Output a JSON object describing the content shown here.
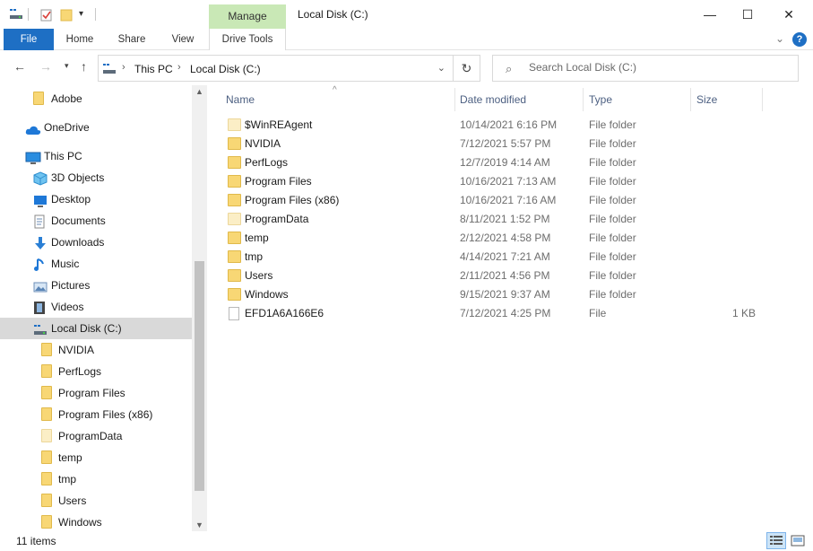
{
  "window": {
    "title": "Local Disk (C:)",
    "minimize_glyph": "—",
    "maximize_glyph": "☐",
    "close_glyph": "✕"
  },
  "ribbon": {
    "contextual_group": "Manage",
    "tabs": [
      "File",
      "Home",
      "Share",
      "View",
      "Drive Tools"
    ],
    "help_glyph": "?"
  },
  "address_bar": {
    "crumbs": [
      "This PC",
      "Local Disk (C:)"
    ]
  },
  "search": {
    "placeholder": "Search Local Disk (C:)"
  },
  "nav_pane": {
    "items": [
      {
        "label": "Adobe",
        "icon": "folder-icon",
        "indent": 1
      },
      {
        "label": "OneDrive",
        "icon": "onedrive-icon",
        "indent": 0
      },
      {
        "label": "This PC",
        "icon": "this-pc-icon",
        "indent": 0
      },
      {
        "label": "3D Objects",
        "icon": "3d-objects-icon",
        "indent": 1
      },
      {
        "label": "Desktop",
        "icon": "desktop-icon",
        "indent": 1
      },
      {
        "label": "Documents",
        "icon": "documents-icon",
        "indent": 1
      },
      {
        "label": "Downloads",
        "icon": "downloads-icon",
        "indent": 1
      },
      {
        "label": "Music",
        "icon": "music-icon",
        "indent": 1
      },
      {
        "label": "Pictures",
        "icon": "pictures-icon",
        "indent": 1
      },
      {
        "label": "Videos",
        "icon": "videos-icon",
        "indent": 1
      },
      {
        "label": "Local Disk (C:)",
        "icon": "drive-icon",
        "indent": 1,
        "selected": true
      },
      {
        "label": "NVIDIA",
        "icon": "folder-icon",
        "indent": 2
      },
      {
        "label": "PerfLogs",
        "icon": "folder-icon",
        "indent": 2
      },
      {
        "label": "Program Files",
        "icon": "folder-icon",
        "indent": 2
      },
      {
        "label": "Program Files (x86)",
        "icon": "folder-icon",
        "indent": 2
      },
      {
        "label": "ProgramData",
        "icon": "folder-pale-icon",
        "indent": 2
      },
      {
        "label": "temp",
        "icon": "folder-icon",
        "indent": 2
      },
      {
        "label": "tmp",
        "icon": "folder-icon",
        "indent": 2
      },
      {
        "label": "Users",
        "icon": "folder-icon",
        "indent": 2
      },
      {
        "label": "Windows",
        "icon": "folder-icon",
        "indent": 2
      }
    ]
  },
  "file_list": {
    "columns": [
      "Name",
      "Date modified",
      "Type",
      "Size"
    ],
    "rows": [
      {
        "name": "$WinREAgent",
        "date": "10/14/2021 6:16 PM",
        "type": "File folder",
        "size": "",
        "icon": "folder-pale-icon"
      },
      {
        "name": "NVIDIA",
        "date": "7/12/2021 5:57 PM",
        "type": "File folder",
        "size": "",
        "icon": "folder-icon"
      },
      {
        "name": "PerfLogs",
        "date": "12/7/2019 4:14 AM",
        "type": "File folder",
        "size": "",
        "icon": "folder-icon"
      },
      {
        "name": "Program Files",
        "date": "10/16/2021 7:13 AM",
        "type": "File folder",
        "size": "",
        "icon": "folder-icon"
      },
      {
        "name": "Program Files (x86)",
        "date": "10/16/2021 7:16 AM",
        "type": "File folder",
        "size": "",
        "icon": "folder-icon"
      },
      {
        "name": "ProgramData",
        "date": "8/11/2021 1:52 PM",
        "type": "File folder",
        "size": "",
        "icon": "folder-pale-icon"
      },
      {
        "name": "temp",
        "date": "2/12/2021 4:58 PM",
        "type": "File folder",
        "size": "",
        "icon": "folder-icon"
      },
      {
        "name": "tmp",
        "date": "4/14/2021 7:21 AM",
        "type": "File folder",
        "size": "",
        "icon": "folder-icon"
      },
      {
        "name": "Users",
        "date": "2/11/2021 4:56 PM",
        "type": "File folder",
        "size": "",
        "icon": "folder-icon"
      },
      {
        "name": "Windows",
        "date": "9/15/2021 9:37 AM",
        "type": "File folder",
        "size": "",
        "icon": "folder-icon"
      },
      {
        "name": "EFD1A6A166E6",
        "date": "7/12/2021 4:25 PM",
        "type": "File",
        "size": "1 KB",
        "icon": "file-icon"
      }
    ]
  },
  "status_bar": {
    "item_count": "11 items"
  },
  "colors": {
    "file_tab": "#1e6fc4",
    "manage_tab": "#c9e8b6",
    "selection": "#d9d9d9",
    "folder": "#f8d775"
  }
}
